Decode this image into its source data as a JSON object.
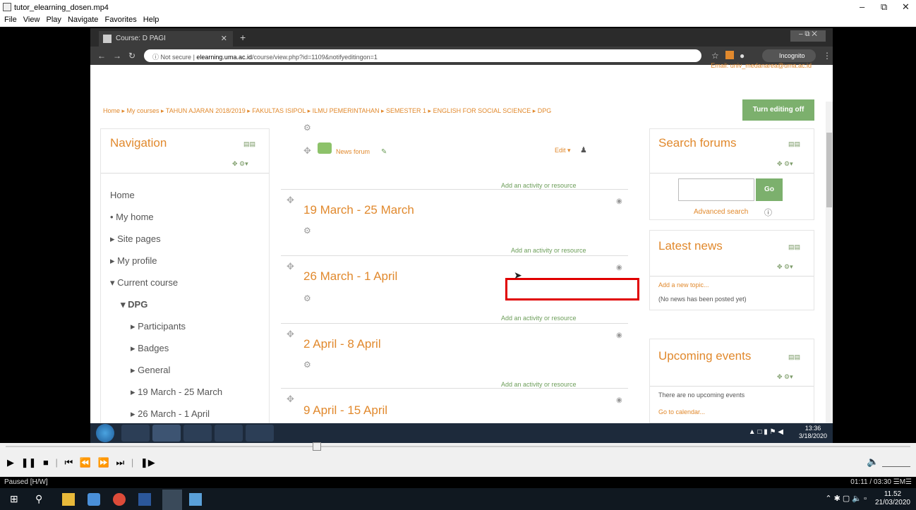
{
  "player": {
    "title": "tutor_elearning_dosen.mp4",
    "menu": [
      "File",
      "View",
      "Play",
      "Navigate",
      "Favorites",
      "Help"
    ],
    "status": "Paused [H/W]",
    "time": "01:11 / 03:30",
    "time_suffix": "☰M☰",
    "progress": 0.338
  },
  "browser": {
    "tab_title": "Course: D PAGI",
    "url_prefix": "Not secure",
    "url_host": "elearning.uma.ac.id",
    "url_path": "/course/view.php?id=1109&notifyeditingon=1",
    "incognito_label": "Incognito"
  },
  "page": {
    "top_email": "Email: univ_medanarea@uma.ac.id",
    "breadcrumb": "Home ▸ My courses ▸ TAHUN AJARAN 2018/2019 ▸ FAKULTAS ISIPOL ▸ ILMU PEMERINTAHAN ▸ SEMESTER 1 ▸ ENGLISH FOR SOCIAL SCIENCE ▸ DPG",
    "edit_button": "Turn editing off"
  },
  "navigation": {
    "title": "Navigation",
    "items": [
      {
        "label": "Home"
      },
      {
        "label": "• My home"
      },
      {
        "label": "▸ Site pages"
      },
      {
        "label": "▸ My profile"
      },
      {
        "label": "▾ Current course"
      },
      {
        "label": "▾ DPG"
      },
      {
        "label": "▸ Participants"
      },
      {
        "label": "▸ Badges"
      },
      {
        "label": "▸ General"
      },
      {
        "label": "▸ 19 March - 25 March"
      },
      {
        "label": "▸ 26 March - 1 April"
      }
    ]
  },
  "course": {
    "news_forum": "News forum",
    "edit_label": "Edit ▾",
    "add_activity": "Add an activity or resource",
    "sections": [
      {
        "title": "19 March - 25 March"
      },
      {
        "title": "26 March - 1 April"
      },
      {
        "title": "2 April - 8 April"
      },
      {
        "title": "9 April - 15 April"
      }
    ]
  },
  "search_forums": {
    "title": "Search forums",
    "go": "Go",
    "advanced": "Advanced search"
  },
  "latest_news": {
    "title": "Latest news",
    "add_topic": "Add a new topic...",
    "empty": "(No news has been posted yet)"
  },
  "upcoming": {
    "title": "Upcoming events",
    "empty": "There are no upcoming events",
    "calendar": "Go to calendar..."
  },
  "w7": {
    "time": "13:36",
    "date": "3/18/2020"
  },
  "w10": {
    "time": "11.52",
    "date": "21/03/2020"
  }
}
